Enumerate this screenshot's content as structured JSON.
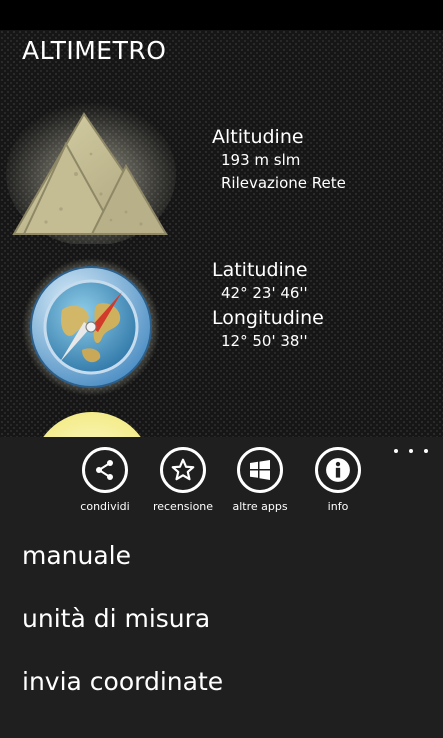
{
  "app": {
    "title": "ALTIMETRO"
  },
  "altitude": {
    "heading": "Altitudine",
    "value": "193 m slm",
    "source": "Rilevazione Rete"
  },
  "position": {
    "latitude_heading": "Latitudine",
    "latitude_value": "42° 23' 46''",
    "longitude_heading": "Longitudine",
    "longitude_value": "12° 50' 38''"
  },
  "appbar": {
    "buttons": [
      {
        "label": "condividi",
        "icon": "share-icon"
      },
      {
        "label": "recensione",
        "icon": "star-icon"
      },
      {
        "label": "altre apps",
        "icon": "windows-icon"
      },
      {
        "label": "info",
        "icon": "info-icon"
      }
    ],
    "menu_items": [
      {
        "label": "manuale"
      },
      {
        "label": "unità di misura"
      },
      {
        "label": "invia coordinate"
      }
    ]
  },
  "colors": {
    "background": "#000000",
    "appbar_background": "#1f1f1f",
    "text": "#ffffff"
  }
}
